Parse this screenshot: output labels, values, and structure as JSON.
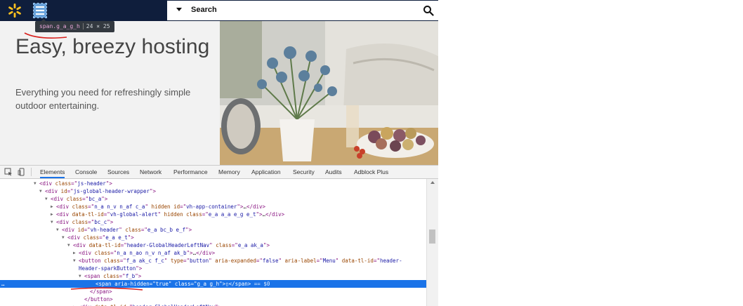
{
  "header": {
    "logo": "walmart-spark-logo",
    "menu_icon": "hamburger-icon",
    "search_placeholder": "Search",
    "search_icon": "magnifier-icon",
    "colors": {
      "bar": "#0f1e3c",
      "spark": "#ffc220",
      "menu_highlight": "#6aa3dc"
    }
  },
  "tooltip": {
    "selector": "span.g_a_g_h",
    "size": "24 × 25"
  },
  "hero": {
    "title": "Easy, breezy hosting",
    "subtitle": "Everything you need for refreshingly simple outdoor entertaining.",
    "photo": "table-with-thistle-flowers-and-potatoes"
  },
  "devtools": {
    "tabs": [
      "Elements",
      "Console",
      "Sources",
      "Network",
      "Performance",
      "Memory",
      "Application",
      "Security",
      "Audits",
      "Adblock Plus"
    ],
    "active_tab": "Elements",
    "selected_suffix": " == $0",
    "tree": [
      {
        "tw": "▼",
        "parts": [
          [
            "t",
            "<div "
          ],
          [
            "a",
            "class"
          ],
          [
            "t",
            "=\""
          ],
          [
            "v",
            "js-header"
          ],
          [
            "t",
            "\">"
          ]
        ]
      },
      {
        "tw": "▼",
        "parts": [
          [
            "t",
            "<div "
          ],
          [
            "a",
            "id"
          ],
          [
            "t",
            "=\""
          ],
          [
            "v",
            "js-global-header-wrapper"
          ],
          [
            "t",
            "\">"
          ]
        ]
      },
      {
        "tw": "▼",
        "parts": [
          [
            "t",
            "<div "
          ],
          [
            "a",
            "class"
          ],
          [
            "t",
            "=\""
          ],
          [
            "v",
            "bc_a"
          ],
          [
            "t",
            "\">"
          ]
        ]
      },
      {
        "tw": "▶",
        "parts": [
          [
            "t",
            "<div "
          ],
          [
            "a",
            "class"
          ],
          [
            "t",
            "=\""
          ],
          [
            "v",
            "n_a n_v n_af c_a"
          ],
          [
            "t",
            "\" "
          ],
          [
            "a",
            "hidden id"
          ],
          [
            "t",
            "=\""
          ],
          [
            "v",
            "vh-app-container"
          ],
          [
            "t",
            "\">"
          ],
          [
            "c",
            "…"
          ],
          [
            "t",
            "</div>"
          ]
        ]
      },
      {
        "tw": "▶",
        "parts": [
          [
            "t",
            "<div "
          ],
          [
            "a",
            "data-tl-id"
          ],
          [
            "t",
            "=\""
          ],
          [
            "v",
            "vh-global-alert"
          ],
          [
            "t",
            "\" "
          ],
          [
            "a",
            "hidden class"
          ],
          [
            "t",
            "=\""
          ],
          [
            "v",
            "e_a a_a e_g e_t"
          ],
          [
            "t",
            "\">"
          ],
          [
            "c",
            "…"
          ],
          [
            "t",
            "</div>"
          ]
        ]
      },
      {
        "tw": "▼",
        "parts": [
          [
            "t",
            "<div "
          ],
          [
            "a",
            "class"
          ],
          [
            "t",
            "=\""
          ],
          [
            "v",
            "bc_c"
          ],
          [
            "t",
            "\">"
          ]
        ]
      },
      {
        "tw": "▼",
        "parts": [
          [
            "t",
            "<div "
          ],
          [
            "a",
            "id"
          ],
          [
            "t",
            "=\""
          ],
          [
            "v",
            "vh-header"
          ],
          [
            "t",
            "\" "
          ],
          [
            "a",
            "class"
          ],
          [
            "t",
            "=\""
          ],
          [
            "v",
            "e_a bc_b e_f"
          ],
          [
            "t",
            "\">"
          ]
        ]
      },
      {
        "tw": "▼",
        "parts": [
          [
            "t",
            "<div "
          ],
          [
            "a",
            "class"
          ],
          [
            "t",
            "=\""
          ],
          [
            "v",
            "e_a e_t"
          ],
          [
            "t",
            "\">"
          ]
        ]
      },
      {
        "tw": "▼",
        "parts": [
          [
            "t",
            "<div "
          ],
          [
            "a",
            "data-tl-id"
          ],
          [
            "t",
            "=\""
          ],
          [
            "v",
            "header-GlobalHeaderLeftNav"
          ],
          [
            "t",
            "\" "
          ],
          [
            "a",
            "class"
          ],
          [
            "t",
            "=\""
          ],
          [
            "v",
            "e_a ak_a"
          ],
          [
            "t",
            "\">"
          ]
        ]
      },
      {
        "tw": "▶",
        "parts": [
          [
            "t",
            "<div "
          ],
          [
            "a",
            "class"
          ],
          [
            "t",
            "=\""
          ],
          [
            "v",
            "n_a n_ao n_v n_af ak_b"
          ],
          [
            "t",
            "\">"
          ],
          [
            "c",
            "…"
          ],
          [
            "t",
            "</div>"
          ]
        ]
      },
      {
        "tw": "▼",
        "parts": [
          [
            "t",
            "<button "
          ],
          [
            "a",
            "class"
          ],
          [
            "t",
            "=\""
          ],
          [
            "v",
            "f_a ak_c f_c"
          ],
          [
            "t",
            "\" "
          ],
          [
            "a",
            "type"
          ],
          [
            "t",
            "=\""
          ],
          [
            "v",
            "button"
          ],
          [
            "t",
            "\" "
          ],
          [
            "a",
            "aria-expanded"
          ],
          [
            "t",
            "=\""
          ],
          [
            "v",
            "false"
          ],
          [
            "t",
            "\" "
          ],
          [
            "a",
            "aria-label"
          ],
          [
            "t",
            "=\""
          ],
          [
            "v",
            "Menu"
          ],
          [
            "t",
            "\" "
          ],
          [
            "a",
            "data-tl-id"
          ],
          [
            "t",
            "=\""
          ],
          [
            "v",
            "header-"
          ]
        ]
      },
      {
        "tw": "",
        "parts": [
          [
            "v",
            "Header-sparkButton"
          ],
          [
            "t",
            "\">"
          ]
        ]
      },
      {
        "tw": "▼",
        "parts": [
          [
            "t",
            "<span "
          ],
          [
            "a",
            "class"
          ],
          [
            "t",
            "=\""
          ],
          [
            "v",
            "f_b"
          ],
          [
            "t",
            "\">"
          ]
        ]
      },
      {
        "tw": "",
        "parts": [
          [
            "t",
            "<span "
          ],
          [
            "a",
            "aria-hidden"
          ],
          [
            "t",
            "=\""
          ],
          [
            "v",
            "true"
          ],
          [
            "t",
            "\" "
          ],
          [
            "a",
            "class"
          ],
          [
            "t",
            "=\""
          ],
          [
            "v",
            "g_a g_h"
          ],
          [
            "t",
            "\">"
          ],
          [
            "c",
            "▯"
          ],
          [
            "t",
            "</span>"
          ]
        ],
        "selected": true
      },
      {
        "tw": "",
        "parts": [
          [
            "t",
            "</span>"
          ]
        ]
      },
      {
        "tw": "",
        "parts": [
          [
            "t",
            "</button>"
          ]
        ]
      },
      {
        "tw": "▶",
        "parts": [
          [
            "t",
            "<div "
          ],
          [
            "a",
            "data-tl-id"
          ],
          [
            "t",
            "=\""
          ],
          [
            "v",
            "header-GlobalHeaderLeftNav"
          ],
          [
            "t",
            "\">"
          ]
        ]
      }
    ]
  }
}
